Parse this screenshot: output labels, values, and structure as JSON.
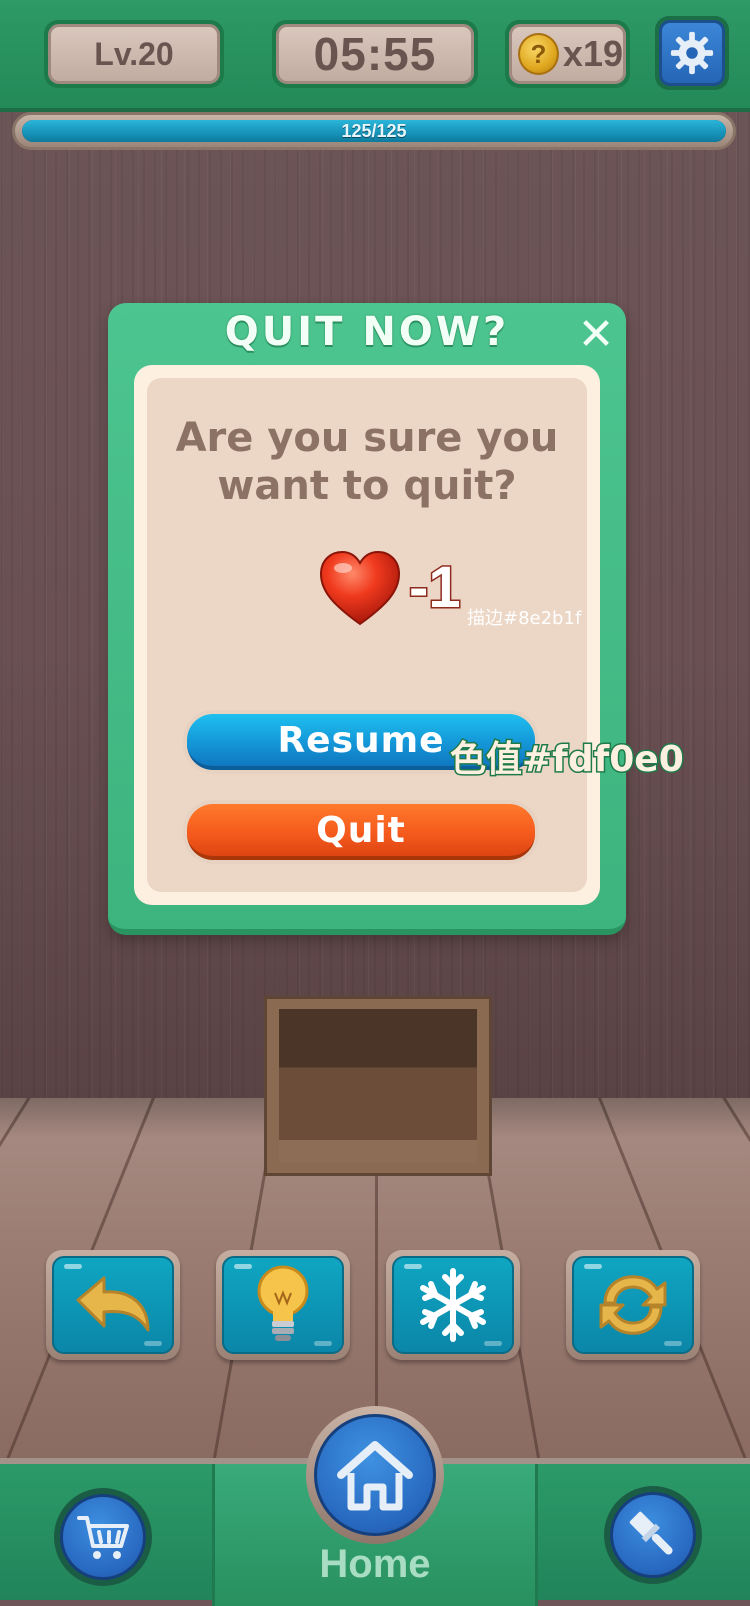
{
  "hud": {
    "level": "Lv.20",
    "timer": "05:55",
    "coin_icon_glyph": "?",
    "coin_count": "x19",
    "settings_icon": "gear-icon"
  },
  "progress": {
    "text": "125/125",
    "current": 125,
    "max": 125
  },
  "dialog": {
    "title": "QUIT NOW?",
    "close_glyph": "✕",
    "message_line1": "Are you sure you",
    "message_line2": "want to quit?",
    "penalty": "-1",
    "stroke_note": "描边#8e2b1f",
    "resume_label": "Resume",
    "quit_label": "Quit",
    "color_note": "色值#fdf0e0"
  },
  "tools": [
    {
      "name": "undo",
      "icon": "undo-arrow-icon"
    },
    {
      "name": "hint",
      "icon": "lightbulb-icon"
    },
    {
      "name": "freeze",
      "icon": "snowflake-icon"
    },
    {
      "name": "shuffle",
      "icon": "refresh-icon"
    }
  ],
  "nav": {
    "home_label": "Home",
    "shop_icon": "cart-icon",
    "home_icon": "house-icon",
    "brush_icon": "paintbrush-icon"
  },
  "colors": {
    "dialog_bg": "#fdf0e0",
    "penalty_stroke": "#8e2b1f",
    "dialog_frame": "#45bd86",
    "resume": "#1497d8",
    "quit": "#f4581c"
  }
}
